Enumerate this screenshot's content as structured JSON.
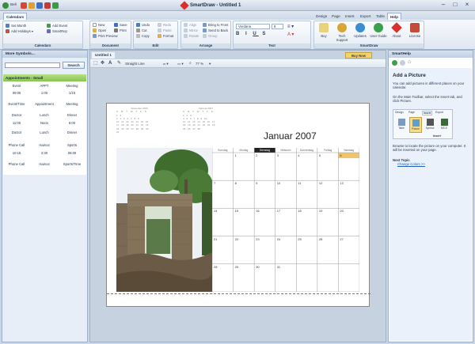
{
  "titlebar": {
    "quick_access_label": "Bell",
    "app_title": "SmartDraw - Untitled 1"
  },
  "menu": {
    "file_tab": "Calendars",
    "tabs": [
      "Design",
      "Page",
      "Insert",
      "Export",
      "Table",
      "Help"
    ],
    "active": "Help"
  },
  "ribbon": {
    "calendars": {
      "label": "Calendars",
      "items": [
        "Set Month",
        "Add Holidays",
        "Add Event",
        "SmartRep"
      ]
    },
    "document": {
      "label": "Document",
      "items": [
        "New",
        "Open",
        "Print Preview",
        "Save",
        "Print"
      ]
    },
    "edit": {
      "label": "Edit",
      "items": [
        "Undo",
        "Cut",
        "Copy",
        "Redo",
        "Paste",
        "Format"
      ]
    },
    "arrange": {
      "label": "Arrange",
      "items": [
        "Align",
        "Mirror",
        "Rotate",
        "Bring to Front",
        "Send to Back",
        "Group"
      ]
    },
    "text": {
      "label": "Text",
      "font": "Verdana",
      "size": "8"
    },
    "smartdraw": {
      "label": "SmartDraw",
      "buttons": [
        "Buy",
        "Tech Support",
        "Updates",
        "User Guide",
        "About",
        "License"
      ]
    }
  },
  "left": {
    "search_title": "More Symbols...",
    "search_button": "Search",
    "library_title": "Appointments - Small",
    "cells": [
      [
        "Event",
        "APPT",
        "Meeting"
      ],
      [
        "09:00",
        "1:00",
        "1/15"
      ],
      [
        "Event/Time",
        "Appointment",
        "Meeting"
      ],
      [
        "Doctor",
        "Lunch",
        "Dinner"
      ],
      [
        "11:00",
        "Noon",
        "6:00"
      ],
      [
        "Doctor",
        "Lunch",
        "Dinner"
      ],
      [
        "Phone Call",
        "Haircut",
        "Sports"
      ],
      [
        "10:15",
        "2:30",
        "06:00"
      ],
      [
        "Phone Call",
        "Haircut",
        "Sports/Time"
      ]
    ]
  },
  "doc": {
    "tab": "Untitled 1",
    "toolbar": {
      "line_style": "Straight Line",
      "zoom": "77 %"
    },
    "buy_button": "Buy Now",
    "calendar": {
      "title": "Januar 2007",
      "mini_prev": "Dezember 2006",
      "mini_next": "Februar 2007",
      "days": [
        "Sonntag",
        "Montag",
        "Dienstag",
        "Mittwoch",
        "Donnerstag",
        "Freitag",
        "Samstag"
      ],
      "mini_days": [
        "S",
        "M",
        "T",
        "W",
        "T",
        "F",
        "S"
      ],
      "mini_prev_rows": [
        "1 2",
        "3 4 5 6 7 8 9",
        "10 11 12 13 14 15 16",
        "17 18 19 20 21 22 23",
        "24 25 26 27 28 29 30",
        "31"
      ],
      "mini_next_rows": [
        "1 2 3",
        "4 5 6 7 8 9 10",
        "11 12 13 14 15 16 17",
        "18 19 20 21 22 23 24",
        "25 26 27 28"
      ],
      "weeks": [
        [
          "",
          "1",
          "2",
          "3",
          "4",
          "5",
          "6"
        ],
        [
          "7",
          "8",
          "9",
          "10",
          "11",
          "12",
          "13"
        ],
        [
          "14",
          "15",
          "16",
          "17",
          "18",
          "19",
          "20"
        ],
        [
          "21",
          "22",
          "23",
          "24",
          "25",
          "26",
          "27"
        ],
        [
          "28",
          "29",
          "30",
          "31",
          "",
          "",
          ""
        ]
      ]
    }
  },
  "right": {
    "title": "SmartHelp",
    "heading": "Add a Picture",
    "p1": "You can add pictures in different places on your calendar.",
    "p2": "On the Main Toolbar, select the Insert tab, and click Picture.",
    "mini_tabs": [
      "Design",
      "Page",
      "Insert",
      "Export"
    ],
    "mini_buttons": [
      "Table",
      "Picture",
      "Symbol",
      "MS-E"
    ],
    "mini_group": "Insert",
    "p3": "Browse to locate the picture on your computer. It will be inserted on your page.",
    "next_label": "Next Topic",
    "next_link": "Change Colors >>"
  }
}
